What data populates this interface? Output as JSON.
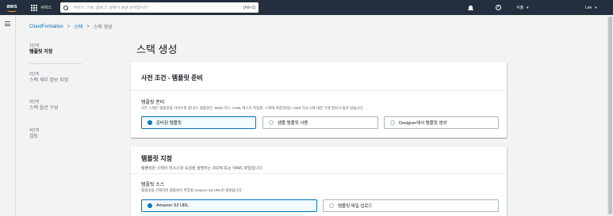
{
  "topnav": {
    "logo_text": "aws",
    "services_label": "서비스",
    "search_placeholder": "서비스, 기능, 블로그, 설명서 등을 검색합니다.",
    "search_shortcut": "[Alt+S]",
    "help_glyph": "?",
    "region_label": "서울",
    "user_label": "Lee",
    "caret": "▼"
  },
  "breadcrumb": {
    "items": [
      "CloudFormation",
      "스택",
      "스택 생성"
    ],
    "separator": ">"
  },
  "steps": [
    {
      "num": "1단계",
      "label": "템플릿 지정"
    },
    {
      "num": "2단계",
      "label": "스택 세부 정보 지정"
    },
    {
      "num": "3단계",
      "label": "스택 옵션 구성"
    },
    {
      "num": "4단계",
      "label": "검토"
    }
  ],
  "page_title": "스택 생성",
  "prereq_panel": {
    "title": "사전 조건 - 템플릿 준비",
    "field_label": "템플릿 준비",
    "field_desc": "모든 스택은 템플릿을 기반으로 합니다. 템플릿은 JSON 또는 YAML 텍스트 파일로, 스택에 포함하려는 AWS 리소스에 대한 구성 정보가 들어 있습니다.",
    "options": [
      "준비된 템플릿",
      "샘플 템플릿 사용",
      "Designer에서 템플릿 생성"
    ],
    "selected_index": 0
  },
  "template_panel": {
    "title": "템플릿 지정",
    "desc": "템플릿은 스택의 리소스와 속성을 설명하는 JSON 또는 YAML 파일입니다.",
    "field_label": "템플릿 소스",
    "field_desc": "템플릿을 선택하면 템플릿이 저장될 Amazon S3 URL이 생성됩니다.",
    "options": [
      "Amazon S3 URL",
      "템플릿 파일 업로드"
    ],
    "selected_index": 0
  },
  "colors": {
    "nav_bg": "#232f3e",
    "accent": "#0073bb",
    "logo_smile": "#ff9900",
    "page_bg": "#f2f3f3"
  }
}
